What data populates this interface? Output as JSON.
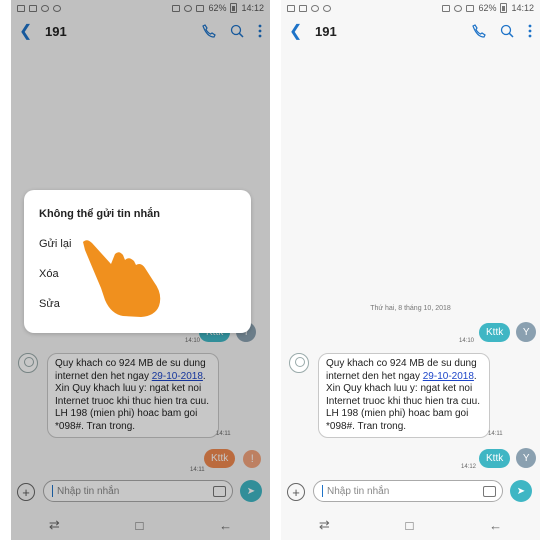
{
  "status_bar": {
    "battery": "62%",
    "time": "14:12"
  },
  "header": {
    "title": "191"
  },
  "icons": {
    "back": "back-arrow-icon",
    "call": "phone-icon",
    "search": "search-icon",
    "more": "more-vert-icon"
  },
  "date_separator": "Thứ hai, 8 tháng 10, 2018",
  "sent_message": {
    "text": "Kttk",
    "time": "14:10"
  },
  "received_message": {
    "line1": "Quy khach co 924 MB de su dung internet den het ngay ",
    "date_link": "29-10-2018",
    "line2": ". Xin Quy khach luu y: ngat ket noi Internet truoc khi thuc hien tra cuu. LH 198 (mien phi) hoac bam goi *098#. Tran trong.",
    "time": "14:11"
  },
  "failed_message": {
    "text": "Kttk",
    "time": "14:11",
    "status_icon": "!"
  },
  "resent_message": {
    "text": "Kttk",
    "time": "14:12"
  },
  "composer": {
    "placeholder": "Nhập tin nhắn"
  },
  "dialog": {
    "title": "Không thể gửi tin nhắn",
    "items": [
      "Gửi lại",
      "Xóa",
      "Sửa"
    ]
  },
  "colors": {
    "accent": "#1e73c8",
    "bubble_out": "#3fb6c4",
    "bubble_failed": "#f08a50",
    "hand": "#f0901e"
  }
}
